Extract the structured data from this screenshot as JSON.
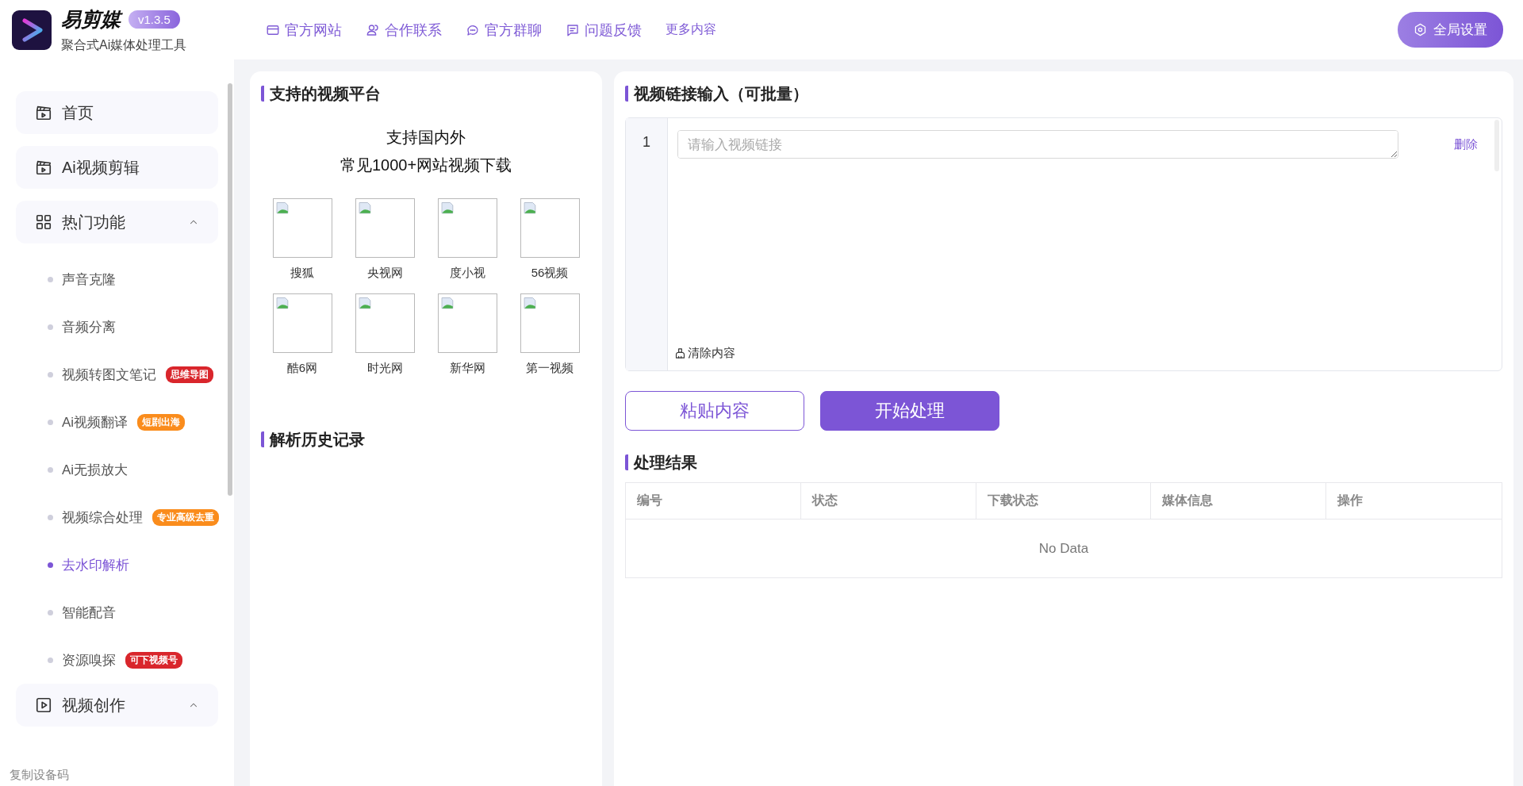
{
  "app": {
    "name": "易剪媒",
    "version": "v1.3.5",
    "subtitle": "聚合式Ai媒体处理工具"
  },
  "top_nav": [
    {
      "label": "官方网站",
      "kind": "site"
    },
    {
      "label": "合作联系",
      "kind": "contact"
    },
    {
      "label": "官方群聊",
      "kind": "chat"
    },
    {
      "label": "问题反馈",
      "kind": "feedback"
    },
    {
      "label": "更多内容",
      "kind": "plain"
    }
  ],
  "settings_button": {
    "label": "全局设置"
  },
  "sidebar": {
    "items": [
      {
        "label": "首页",
        "kind": "page",
        "selected": false
      },
      {
        "label": "Ai视频剪辑",
        "kind": "page",
        "selected": false
      },
      {
        "label": "热门功能",
        "kind": "group",
        "expanded": true,
        "children": [
          {
            "label": "声音克隆",
            "selected": false
          },
          {
            "label": "音频分离",
            "selected": false
          },
          {
            "label": "视频转图文笔记",
            "selected": false,
            "badge": {
              "text": "思维导图",
              "color": "#d9262c"
            }
          },
          {
            "label": "Ai视频翻译",
            "selected": false,
            "badge": {
              "text": "短剧出海",
              "color": "#fa8c1c"
            }
          },
          {
            "label": "Ai无损放大",
            "selected": false
          },
          {
            "label": "视频综合处理",
            "selected": false,
            "badge": {
              "text": "专业高级去重",
              "color": "#fa8c1c"
            }
          },
          {
            "label": "去水印解析",
            "selected": true
          },
          {
            "label": "智能配音",
            "selected": false
          },
          {
            "label": "资源嗅探",
            "selected": false,
            "badge": {
              "text": "可下视频号",
              "color": "#d9262c"
            }
          }
        ]
      },
      {
        "label": "视频创作",
        "kind": "group",
        "expanded": true
      }
    ],
    "footer": "复制设备码"
  },
  "platforms": {
    "title": "支持的视频平台",
    "intro": [
      "支持国内外",
      "常见1000+网站视频下载"
    ],
    "items": [
      "搜狐",
      "央视网",
      "度小视",
      "56视频",
      "酷6网",
      "时光网",
      "新华网",
      "第一视频"
    ]
  },
  "history": {
    "title": "解析历史记录"
  },
  "link_input": {
    "title": "视频链接输入（可批量）",
    "rows": [
      {
        "number": "1",
        "placeholder": "请输入视频链接",
        "action": "删除"
      }
    ],
    "clear_label": "清除内容"
  },
  "actions": [
    {
      "label": "粘贴内容",
      "kind": "outline"
    },
    {
      "label": "开始处理",
      "kind": "primary"
    }
  ],
  "results": {
    "title": "处理结果",
    "columns": [
      "编号",
      "状态",
      "下载状态",
      "媒体信息",
      "操作"
    ],
    "empty_text": "No Data"
  }
}
